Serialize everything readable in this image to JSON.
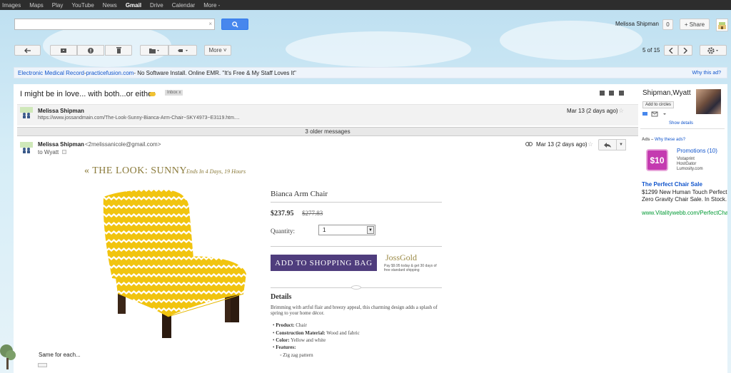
{
  "topnav": [
    "Images",
    "Maps",
    "Play",
    "YouTube",
    "News",
    "Gmail",
    "Drive",
    "Calendar",
    "More -"
  ],
  "topnav_active": "Gmail",
  "search": {
    "value": "",
    "clear": "×"
  },
  "account": {
    "name": "Melissa Shipman",
    "notifications": "0",
    "share_label": "+ Share"
  },
  "toolbar": {
    "more_label": "More ˅",
    "page_count": "5 of 15"
  },
  "ad_bar": {
    "link": "Electronic Medical Record",
    "separator": " - ",
    "domain": "practicefusion.com",
    "text": " - No Software Install. Online EMR. \"It's Free & My Staff Loves It\"",
    "why": "Why this ad?"
  },
  "thread": {
    "subject": "I might be in love... with both...or either",
    "label": "Inbox",
    "label_x": "x",
    "older": "3 older messages"
  },
  "collapsed_msg": {
    "sender": "Melissa Shipman",
    "snippet": "https://www.jossandmain.com/The-Look-Sunny-Bianca-Arm-Chair~SKY4973~E3119.htm....",
    "date": "Mar 13 (2 days ago)"
  },
  "open_msg": {
    "sender": "Melissa Shipman",
    "email": "<2melissanicole@gmail.com>",
    "to": "to Wyatt",
    "date": "Mar 13 (2 days ago)"
  },
  "product": {
    "look_title": "« THE LOOK: SUNNY",
    "look_sub": "Ends In 4 Days, 19 Hours",
    "name": "Bianca Arm Chair",
    "price": "$237.95",
    "old_price": "$277.83",
    "qty_label": "Quantity:",
    "qty_value": "1",
    "add_label": "ADD TO SHOPPING BAG",
    "brand": "JossGold",
    "brand_note": "Pay $9.95 today & get 30 days of free standard shipping",
    "details_title": "Details",
    "description": "Brimming with artful flair and breezy appeal, this charming design adds a splash of spring to your home décor.",
    "specs": [
      {
        "k": "Product:",
        "v": " Chair"
      },
      {
        "k": "Construction Material:",
        "v": " Wood and fabric"
      },
      {
        "k": "Color:",
        "v": " Yellow and white"
      },
      {
        "k": "Features:",
        "v": ""
      }
    ],
    "feature": "Zig zag pattern"
  },
  "body_footer": "Same for each...",
  "sidebar": {
    "contact": "Shipman,Wyatt",
    "circles": "Add to circles",
    "show_details": "Show details",
    "ads_label": "Ads – ",
    "ads_why": "Why these ads?",
    "promo_badge": "$10",
    "promo_title": "Promotions (10)",
    "promo_sources": [
      "Vistaprint",
      "HostGator",
      "Lumosity.com"
    ],
    "ad_title": "The Perfect Chair Sale",
    "ad_text": "$1299 New Human Touch Perfect Zero Gravity Chair Sale. In Stock.",
    "ad_url": "www.Vitalitywebb.com/PerfectChair"
  },
  "colors": {
    "accent": "#4787ed",
    "bag": "#4f3d7d",
    "gold": "#8a7a3a",
    "chair_yellow": "#f1c40f"
  }
}
